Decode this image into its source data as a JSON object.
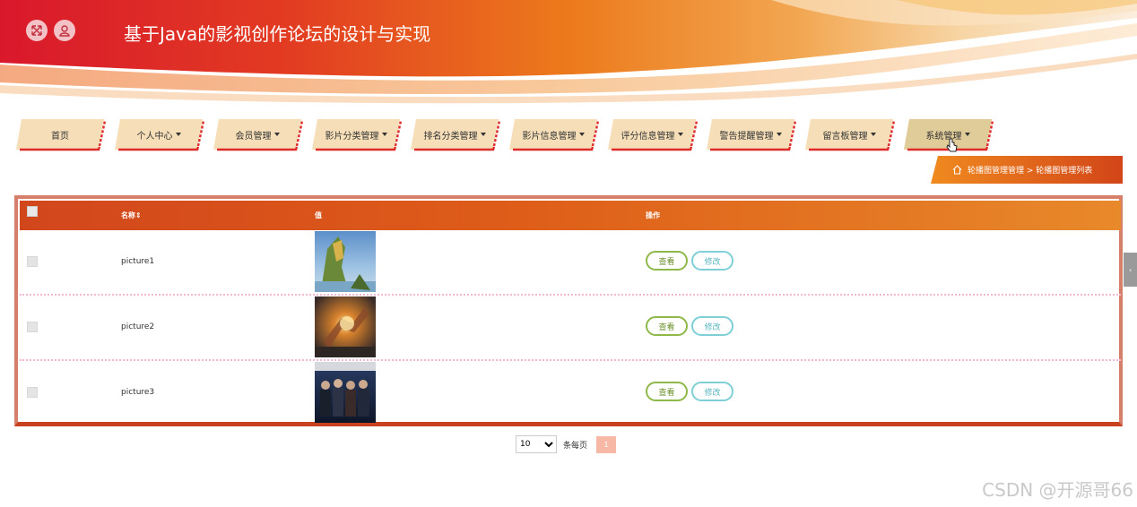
{
  "header": {
    "title": "基于Java的影视创作论坛的设计与实现",
    "buttons": [
      {
        "icon": "expand-arrows-icon"
      },
      {
        "icon": "user-icon"
      }
    ]
  },
  "nav": {
    "items": [
      {
        "label": "首页",
        "dropdown": false
      },
      {
        "label": "个人中心",
        "dropdown": true
      },
      {
        "label": "会员管理",
        "dropdown": true
      },
      {
        "label": "影片分类管理",
        "dropdown": true
      },
      {
        "label": "排名分类管理",
        "dropdown": true
      },
      {
        "label": "影片信息管理",
        "dropdown": true
      },
      {
        "label": "评分信息管理",
        "dropdown": true
      },
      {
        "label": "警告提醒管理",
        "dropdown": true
      },
      {
        "label": "留言板管理",
        "dropdown": true
      },
      {
        "label": "系统管理",
        "dropdown": true,
        "active": true
      }
    ]
  },
  "breadcrumb": {
    "icon": "home-icon",
    "text": "轮播图管理管理 > 轮播图管理列表"
  },
  "table": {
    "columns": {
      "name": "名称⇕",
      "value": "值",
      "actions": "操作"
    },
    "rows": [
      {
        "name": "picture1",
        "view": "查看",
        "edit": "修改"
      },
      {
        "name": "picture2",
        "view": "查看",
        "edit": "修改"
      },
      {
        "name": "picture3",
        "view": "查看",
        "edit": "修改"
      }
    ]
  },
  "pagination": {
    "page_size": "10",
    "page_size_options": [
      "10"
    ],
    "per_page_label": "条每页",
    "current_page": "1"
  },
  "side_tab": {
    "label": "‹"
  },
  "watermark": "CSDN @开源哥66",
  "colors": {
    "accent": "#e0521c",
    "header_red": "#d9202e",
    "header_orange": "#ee8a1e",
    "nav_tab": "#f6dfb8",
    "nav_tab_active": "#e0cc98",
    "view_button": "#8fb84a",
    "edit_button": "#7ecfd6"
  }
}
